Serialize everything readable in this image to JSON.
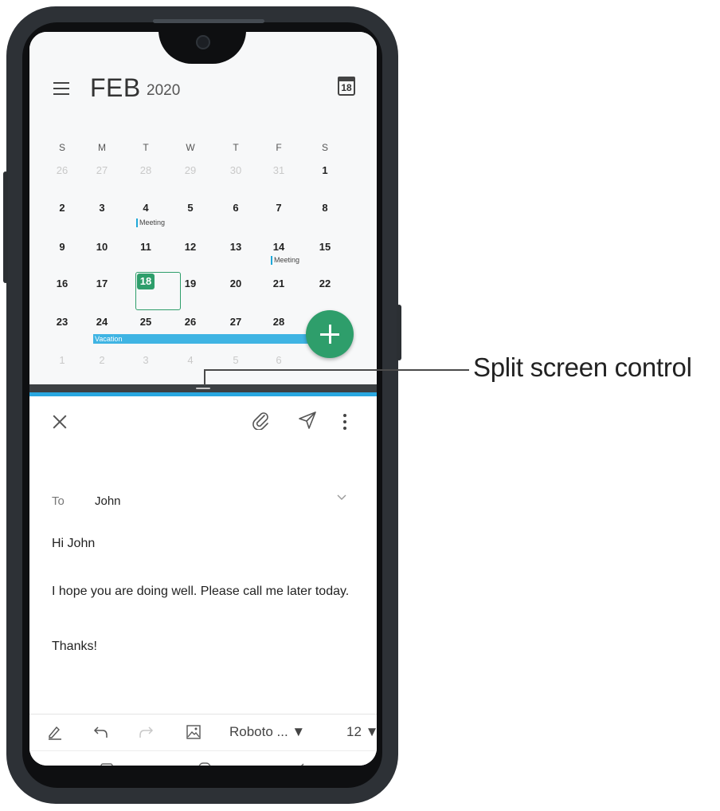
{
  "calendar": {
    "month": "FEB",
    "year": "2020",
    "today_day": "18",
    "weekdays": [
      "S",
      "M",
      "T",
      "W",
      "T",
      "F",
      "S"
    ],
    "rows": [
      [
        "26",
        "27",
        "28",
        "29",
        "30",
        "31",
        "1"
      ],
      [
        "2",
        "3",
        "4",
        "5",
        "6",
        "7",
        "8"
      ],
      [
        "9",
        "10",
        "11",
        "12",
        "13",
        "14",
        "15"
      ],
      [
        "16",
        "17",
        "18",
        "19",
        "20",
        "21",
        "22"
      ],
      [
        "23",
        "24",
        "25",
        "26",
        "27",
        "28",
        ""
      ],
      [
        "1",
        "2",
        "3",
        "4",
        "5",
        "6",
        ""
      ]
    ],
    "events": {
      "feb4": "Meeting",
      "feb14": "Meeting",
      "vacation": "Vacation"
    },
    "fab_icon": "plus-icon"
  },
  "divider": {
    "callout": "Split screen control"
  },
  "email": {
    "to_label": "To",
    "to_value": "John",
    "greeting": "Hi John",
    "body": "I hope you are doing well. Please call me later today.",
    "signoff": "Thanks!",
    "toolbar": {
      "font": "Roboto ... ▼",
      "size": "12 ▼"
    }
  },
  "colors": {
    "accent_green": "#2e9e6b",
    "divider_blue": "#29a7e0",
    "event_blue": "#3fb4e3"
  }
}
